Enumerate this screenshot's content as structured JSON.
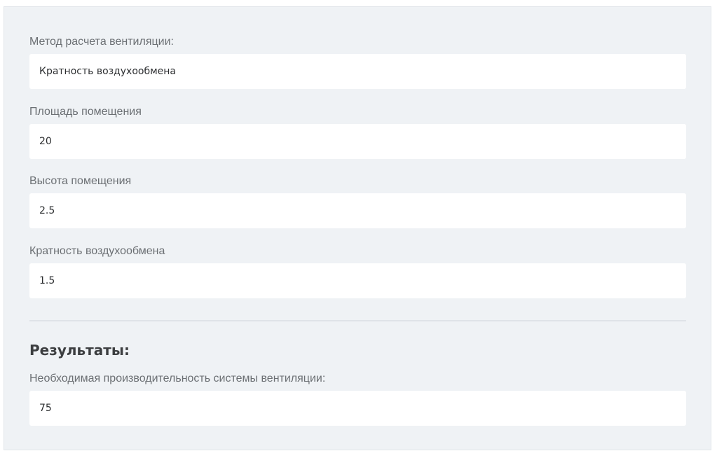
{
  "form": {
    "method": {
      "label": "Метод расчета вентиляции:",
      "value": "Кратность воздухообмена"
    },
    "area": {
      "label": "Площадь помещения",
      "value": "20"
    },
    "height": {
      "label": "Высота помещения",
      "value": "2.5"
    },
    "exchange_rate": {
      "label": "Кратность воздухообмена",
      "value": "1.5"
    }
  },
  "results": {
    "title": "Результаты:",
    "capacity": {
      "label": "Необходимая производительность системы вентиляции:",
      "value": "75"
    }
  }
}
